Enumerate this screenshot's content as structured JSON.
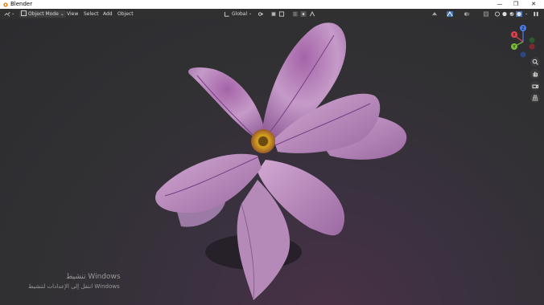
{
  "window": {
    "title": "Blender",
    "controls": [
      "—",
      "❐",
      "✕"
    ]
  },
  "header": {
    "mode": "Object Mode",
    "menus": [
      "View",
      "Select",
      "Add",
      "Object"
    ],
    "orientation": "Global"
  },
  "watermark": {
    "line1": "تنشيط Windows",
    "line2": "انتقل إلى الإعدادات لتنشيط Windows"
  },
  "gizmo": {
    "z": "Z",
    "x": "X",
    "y": "Y"
  },
  "colors": {
    "accent": "#4772b3",
    "x_axis": "#e0434f",
    "y_axis": "#7cba3b",
    "z_axis": "#4c7ee8",
    "flower_petal": "#b27ab8",
    "flower_center": "#d4a11c"
  }
}
